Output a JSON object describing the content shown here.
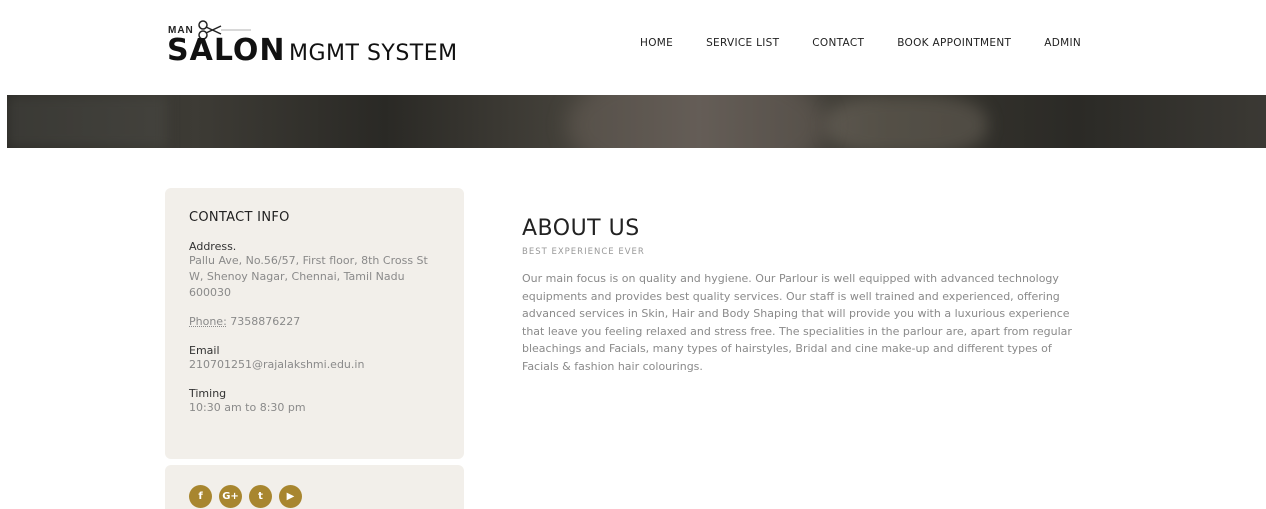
{
  "brand": {
    "small": "MAN",
    "main": "SALON",
    "secondary": "MGMT SYSTEM"
  },
  "nav": {
    "items": [
      {
        "label": "HOME"
      },
      {
        "label": "SERVICE LIST"
      },
      {
        "label": "CONTACT"
      },
      {
        "label": "BOOK APPOINTMENT"
      },
      {
        "label": "ADMIN"
      }
    ]
  },
  "contact": {
    "title": "CONTACT INFO",
    "address_label": "Address.",
    "address_value": "Pallu Ave, No.56/57, First floor, 8th Cross St W, Shenoy Nagar, Chennai, Tamil Nadu 600030",
    "phone_label": "Phone:",
    "phone_value": " 7358876227",
    "email_label": "Email",
    "email_value": "210701251@rajalakshmi.edu.in",
    "timing_label": "Timing",
    "timing_value": "10:30 am to 8:30 pm"
  },
  "social": {
    "icons": [
      "facebook-icon",
      "google-plus-icon",
      "twitter-icon",
      "youtube-icon"
    ],
    "glyphs": [
      "f",
      "G+",
      "t",
      "▶"
    ],
    "accent": "#a8862f"
  },
  "about": {
    "title": "ABOUT US",
    "subtitle": "BEST EXPERIENCE EVER",
    "body": "Our main focus is on quality and hygiene. Our Parlour is well equipped with advanced technology equipments and provides best quality services. Our staff is well trained and experienced, offering advanced services in Skin, Hair and Body Shaping that will provide you with a luxurious experience that leave you feeling relaxed and stress free. The specialities in the parlour are, apart from regular bleachings and Facials, many types of hairstyles, Bridal and cine make-up and different types of Facials & fashion hair colourings."
  }
}
